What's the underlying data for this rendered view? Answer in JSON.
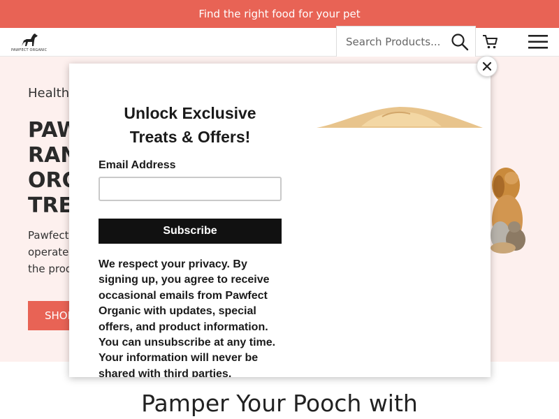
{
  "announcement": {
    "text": "Find the right food for your pet"
  },
  "header": {
    "logo_text": "PAWFECT ORGANIC",
    "search": {
      "placeholder": "Search Products...",
      "value": ""
    },
    "icons": {
      "search": "search-icon",
      "cart": "cart-icon",
      "menu": "hamburger-menu-icon"
    }
  },
  "hero": {
    "eyebrow": "Health",
    "title": "PAW\nRAN\nORG\nTREA",
    "description": "Pawfect\noperated\nthe prod",
    "button_label": "SHOP"
  },
  "section": {
    "title": "Pamper Your Pooch with"
  },
  "modal": {
    "title": "Unlock Exclusive\nTreats & Offers!",
    "email_label": "Email Address",
    "email_value": "",
    "subscribe_label": "Subscribe",
    "privacy_text": "We respect your privacy. By signing up, you agree to receive occasional emails from Pawfect Organic with updates, special offers, and product information. You can unsubscribe at any time. Your information will never be shared with third parties.",
    "close_icon": "close-icon"
  },
  "colors": {
    "accent": "#e86355",
    "hero_bg": "#fdf0ee",
    "button_dark": "#111111"
  }
}
